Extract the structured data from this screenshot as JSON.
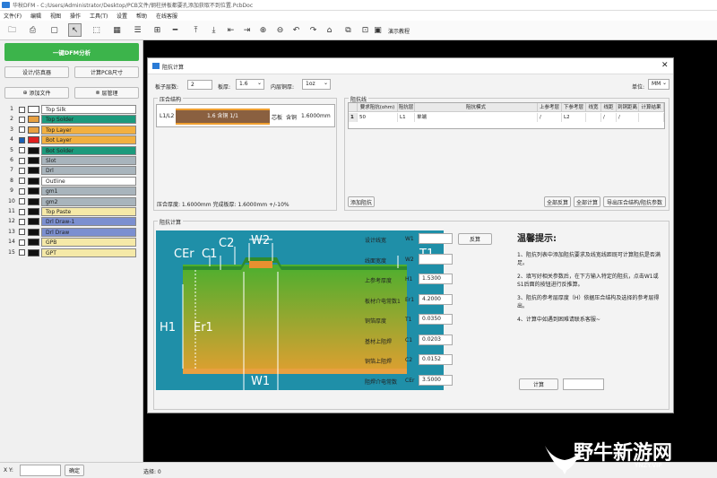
{
  "window": {
    "title": "华秋DFM - C:/Users/Administrator/Desktop/PCB文件/钢柱拼板都要孔添加获取不到位置.PcbDoc"
  },
  "menu": [
    "文件(F)",
    "编辑",
    "视图",
    "操作",
    "工具(T)",
    "设置",
    "帮助",
    "在线客服"
  ],
  "toolbar": {
    "tutorial": "演示教程"
  },
  "left": {
    "dfm_button": "一键DFM分析",
    "design_btn": "设计/仿真器",
    "pcb_size_btn": "计算PCB尺寸",
    "add_file": "添加文件",
    "layer_mgr": "层管理",
    "layers": [
      {
        "num": "1",
        "name": "Top Silk",
        "color": "#ffffff",
        "bg": "#ffffff",
        "checked": false
      },
      {
        "num": "2",
        "name": "Top Solder",
        "color": "#e8a040",
        "bg": "#1c9a7c",
        "checked": false
      },
      {
        "num": "3",
        "name": "Top Layer",
        "color": "#e8a040",
        "bg": "#f2b040",
        "checked": false
      },
      {
        "num": "4",
        "name": "Bot Layer",
        "color": "#e02020",
        "bg": "#f2b040",
        "checked": true
      },
      {
        "num": "5",
        "name": "Bot Solder",
        "color": "#111111",
        "bg": "#1c9a7c",
        "checked": false
      },
      {
        "num": "6",
        "name": "Slot",
        "color": "#111111",
        "bg": "#a8b4bc",
        "checked": false
      },
      {
        "num": "7",
        "name": "Drl",
        "color": "#111111",
        "bg": "#a8b4bc",
        "checked": false
      },
      {
        "num": "8",
        "name": "Outline",
        "color": "#111111",
        "bg": "#ffffff",
        "checked": false
      },
      {
        "num": "9",
        "name": "gm1",
        "color": "#111111",
        "bg": "#a8b4bc",
        "checked": false
      },
      {
        "num": "10",
        "name": "gm2",
        "color": "#111111",
        "bg": "#a8b4bc",
        "checked": false
      },
      {
        "num": "11",
        "name": "Top Paste",
        "color": "#111111",
        "bg": "#f5e9a8",
        "checked": false
      },
      {
        "num": "12",
        "name": "Drl Draw-1",
        "color": "#111111",
        "bg": "#7b8fd0",
        "checked": false
      },
      {
        "num": "13",
        "name": "Drl Draw",
        "color": "#111111",
        "bg": "#7b8fd0",
        "checked": false
      },
      {
        "num": "14",
        "name": "GPB",
        "color": "#111111",
        "bg": "#f5e9a8",
        "checked": false
      },
      {
        "num": "15",
        "name": "GPT",
        "color": "#111111",
        "bg": "#f5e9a8",
        "checked": false
      }
    ]
  },
  "status": {
    "xy_label": "X Y:",
    "confirm": "确定",
    "selected": "选择: 0"
  },
  "dialog": {
    "title": "阻抗计算",
    "layers_label": "板子层数:",
    "layers_val": "2",
    "thick_label": "板厚:",
    "thick_val": "1.6",
    "inner_label": "内层铜厚:",
    "inner_val": "1oz",
    "unit_label": "单位:",
    "unit_val": "MM",
    "stack_group": "压合结构",
    "stack_layers": "L1/L2",
    "stack_core": "1.6 含铜 1/1",
    "stack_type": "芯板",
    "stack_cu": "含铜",
    "stack_thk": "1.6000mm",
    "stack_summary": "压合厚度:   1.6000mm  完成板厚:   1.6000mm  +/-10%",
    "imp_group": "阻抗线",
    "imp_headers": [
      "要求阻抗(ohm)",
      "阻抗层",
      "阻抗模式",
      "上参考层",
      "下参考层",
      "线宽",
      "线距",
      "到铜距离",
      "计算结果"
    ],
    "imp_row": {
      "idx": "1",
      "ohm": "50",
      "layer": "L1",
      "mode": "单端",
      "up": "/",
      "down": "L2",
      "w": "",
      "s": "/",
      "cu": "/",
      "res": ""
    },
    "add_imp": "添加阻抗",
    "clear_all": "全部反算",
    "calc_all": "全部计算",
    "export": "导出压合结构/阻抗参数",
    "calc_group": "阻抗计算",
    "params": [
      {
        "label": "设计线宽",
        "sym": "W1",
        "val": ""
      },
      {
        "label": "线面宽度",
        "sym": "W2",
        "val": ""
      },
      {
        "label": "上参考厚度",
        "sym": "H1",
        "val": "1.5300"
      },
      {
        "label": "板材介电常数1",
        "sym": "Er1",
        "val": "4.2000"
      },
      {
        "label": "铜箔厚度",
        "sym": "T1",
        "val": "0.0350"
      },
      {
        "label": "基材上阻焊",
        "sym": "C1",
        "val": "0.0203"
      },
      {
        "label": "铜箔上阻焊",
        "sym": "C2",
        "val": "0.0152"
      },
      {
        "label": "阻焊介电常数",
        "sym": "CEr",
        "val": "3.5000"
      }
    ],
    "reverse_btn": "反算",
    "calc_btn": "计算",
    "tips_title": "温馨提示:",
    "tips": [
      "1、阻抗列表中添加阻抗要求及线宽线距既可计算阻抗是否满足。",
      "2、填写好相关参数后，在下方输入特定的阻抗，点击W1或S1后面的按钮进行反推算。",
      "3、阻抗的参考层厚度（H）依据压合结构及选择的参考层得出。",
      "4、计算中如遇到困难请联系客服~"
    ],
    "diagram": {
      "CEr": "CEr",
      "C1": "C1",
      "C2": "C2",
      "W2": "W2",
      "T1": "T1",
      "H1": "H1",
      "Er1": "Er1",
      "W1": "W1"
    }
  },
  "watermark": {
    "text": "野牛新游网",
    "url": "YNZY.VIP"
  }
}
